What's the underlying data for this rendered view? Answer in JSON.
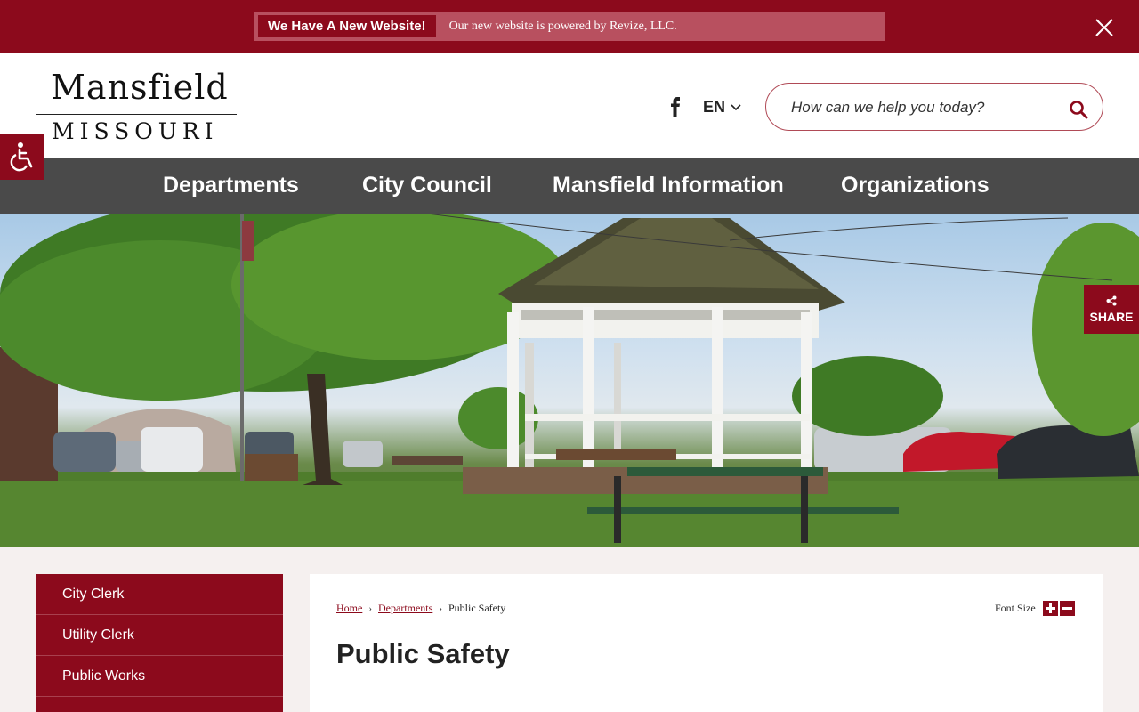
{
  "announcement": {
    "badge": "We Have A New Website!",
    "text": "Our new website is powered by Revize, LLC."
  },
  "logo": {
    "line1": "Mansfield",
    "line2": "MISSOURI"
  },
  "header": {
    "language": "EN",
    "search_placeholder": "How can we help you today?"
  },
  "nav": {
    "items": [
      "Departments",
      "City Council",
      "Mansfield Information",
      "Organizations"
    ]
  },
  "share": {
    "label": "SHARE"
  },
  "sidebar": {
    "items": [
      "City Clerk",
      "Utility Clerk",
      "Public Works",
      ""
    ]
  },
  "breadcrumb": {
    "home": "Home",
    "departments": "Departments",
    "current": "Public Safety"
  },
  "font_size": {
    "label": "Font Size"
  },
  "page": {
    "title": "Public Safety"
  },
  "colors": {
    "brand": "#8c0a1c",
    "nav_bg": "#4a4a4a",
    "page_bg": "#f5f0ef"
  }
}
